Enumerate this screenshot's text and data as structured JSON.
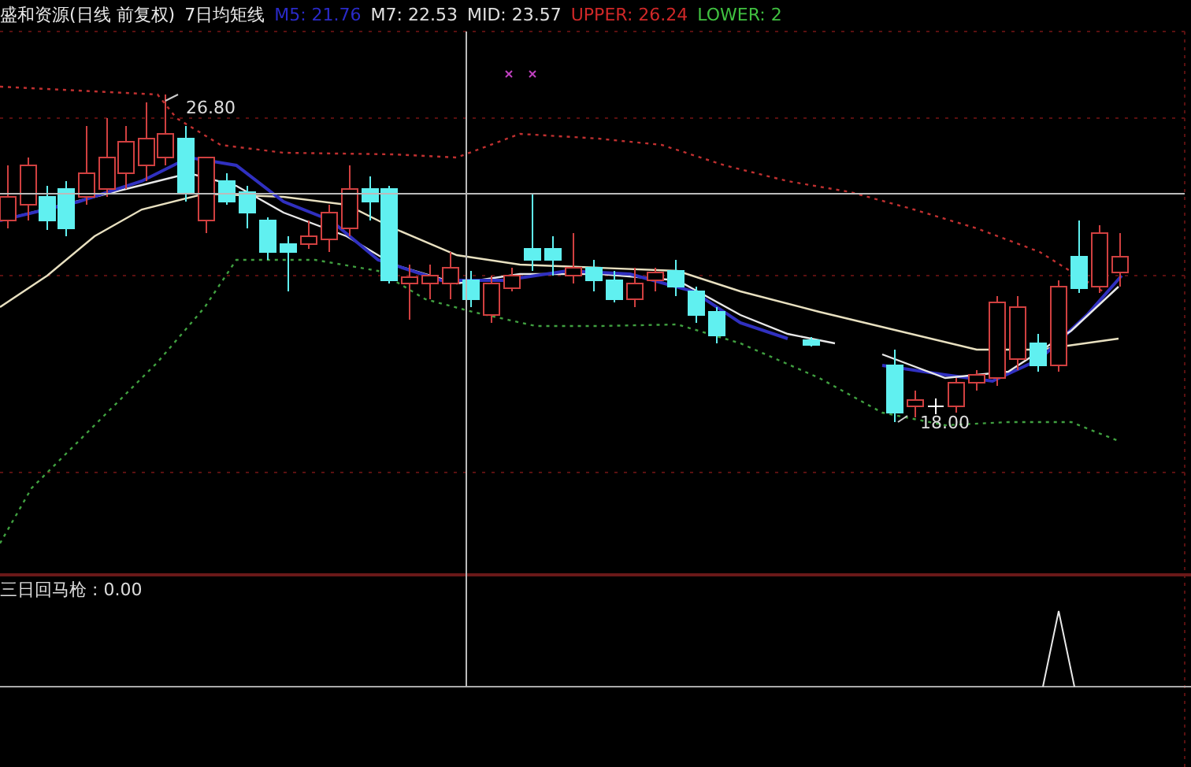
{
  "header": {
    "stock": "盛和资源(日线 前复权)",
    "indicator": "7日均矩线",
    "legend": [
      {
        "label": "M5: 21.76",
        "color": "#2a2ac8"
      },
      {
        "label": "M7: 22.53",
        "color": "#e0e0e0"
      },
      {
        "label": "MID: 23.57",
        "color": "#e0e0e0"
      },
      {
        "label": "UPPER: 26.24",
        "color": "#d02828"
      },
      {
        "label": "LOWER: 2",
        "color": "#40c040"
      }
    ]
  },
  "price_pane": {
    "high_label": "26.80",
    "low_label": "18.00"
  },
  "indicator_pane": {
    "label": "三日回马枪 : 0.00"
  }
}
